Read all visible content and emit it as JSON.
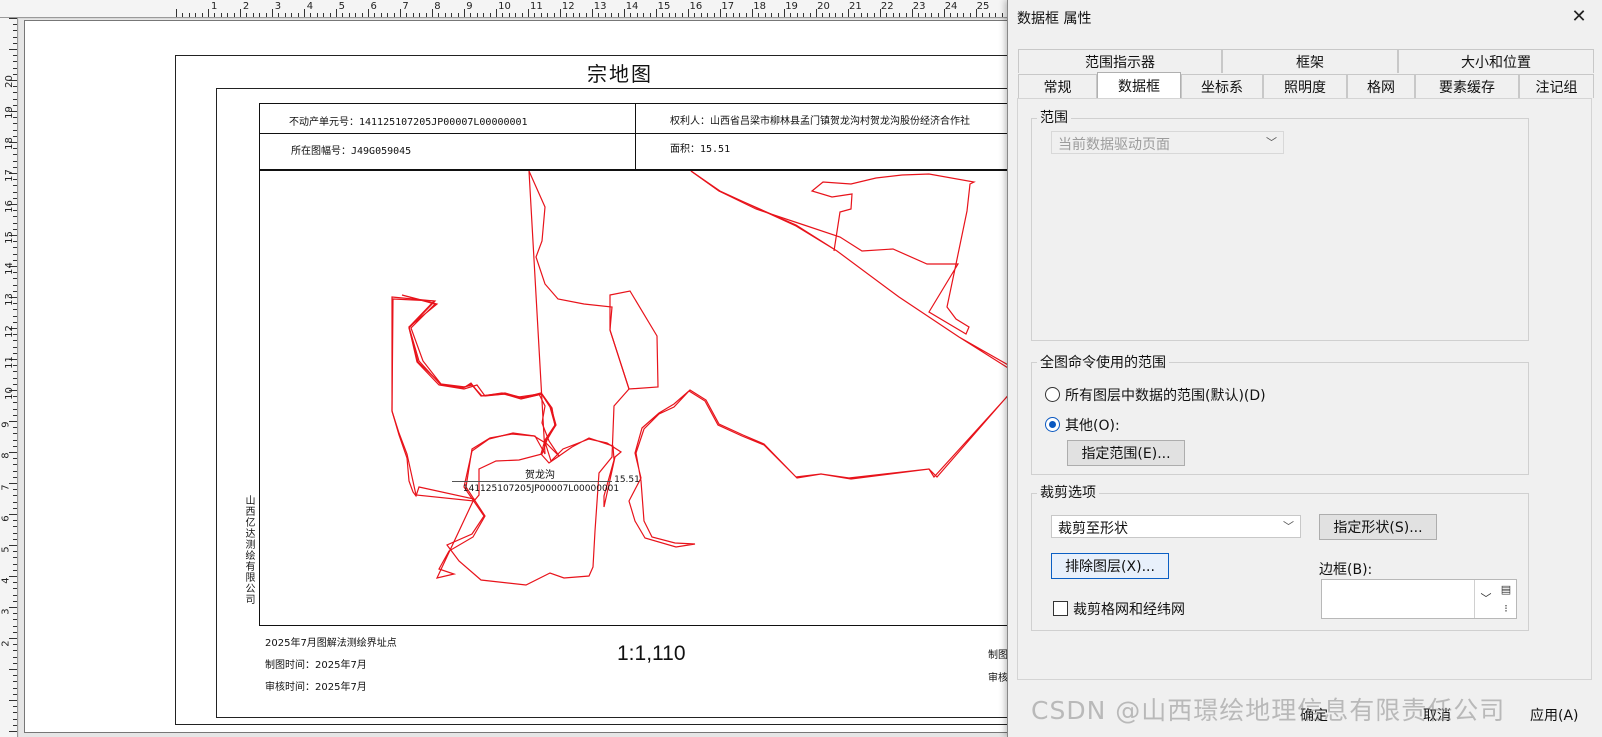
{
  "map": {
    "title": "宗地图",
    "unit_no_label": "不动产单元号：141125107205JP00007L00000001",
    "owner_label": "权利人：山西省吕梁市柳林县孟门镇贺龙沟村贺龙沟股份经济合作社",
    "sheet_no_label": "所在图幅号：J49G059045",
    "area_label": "面积：15.51",
    "parcel_name": "贺龙沟",
    "parcel_area": "15.51",
    "parcel_code": "141125107205JP00007L00000001",
    "company": "山西亿达测绘有限公司",
    "survey_note": "2025年7月图解法测绘界址点",
    "made_date": "制图时间：2025年7月",
    "check_date": "审核时间：2025年7月",
    "scale": "1:1,110",
    "right_footer_1": "制图",
    "right_footer_2": "审核"
  },
  "ruler": {
    "top_numbers": [
      "1",
      "2",
      "3",
      "4",
      "5",
      "6",
      "7",
      "8",
      "9",
      "10",
      "11",
      "12",
      "13",
      "14",
      "15",
      "16",
      "17",
      "18",
      "19",
      "20",
      "21",
      "22",
      "23",
      "24",
      "25"
    ],
    "left_numbers": [
      "20",
      "19",
      "18",
      "17",
      "16",
      "15",
      "14",
      "13",
      "12",
      "11",
      "10",
      "9",
      "8",
      "7",
      "6",
      "5",
      "4",
      "3",
      "2"
    ]
  },
  "dialog": {
    "title": "数据框 属性",
    "close_glyph": "✕",
    "tabs_row1": [
      "范围指示器",
      "框架",
      "大小和位置"
    ],
    "tabs_row2": [
      "常规",
      "数据框",
      "坐标系",
      "照明度",
      "格网",
      "要素缓存",
      "注记组"
    ],
    "active_tab": "数据框",
    "extent_group": "范围",
    "extent_select": "当前数据驱动页面",
    "fullextent_group": "全图命令使用的范围",
    "radio_all": "所有图层中数据的范围(默认)(D)",
    "radio_other": "其他(O):",
    "specify_extent_btn": "指定范围(E)...",
    "clip_group": "裁剪选项",
    "clip_select": "裁剪至形状",
    "specify_shape_btn": "指定形状(S)...",
    "exclude_layers_btn": "排除图层(X)...",
    "border_label": "边框(B):",
    "clip_grid_check": "裁剪格网和经纬网",
    "ok": "确定",
    "cancel": "取消",
    "apply": "应用(A)"
  },
  "watermark": "CSDN @山西璟绘地理信息有限责任公司",
  "colors": {
    "parcel_line": "#e8131b",
    "radio_accent": "#0a58c0"
  }
}
